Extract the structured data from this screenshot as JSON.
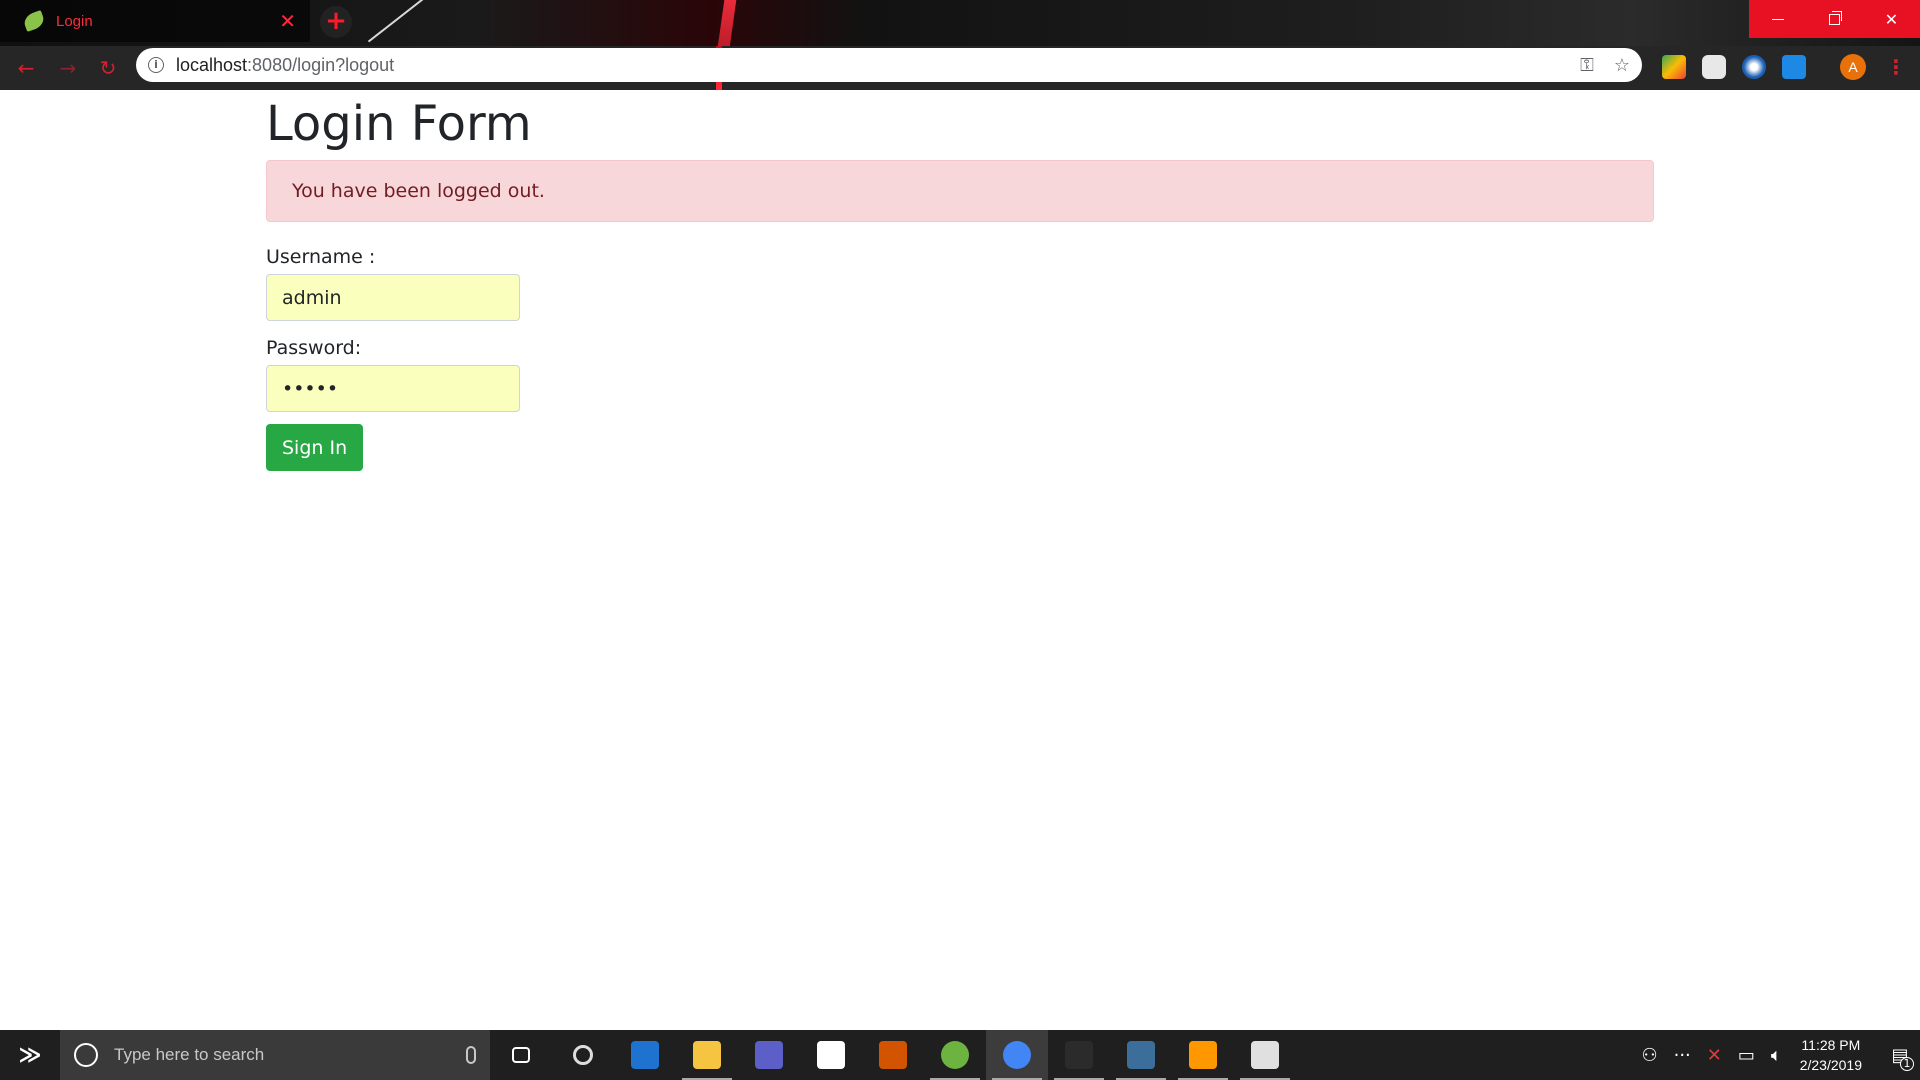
{
  "browser": {
    "tab_title": "Login",
    "tab_close": "✕",
    "new_tab": "+",
    "url_host": "localhost",
    "url_rest": ":8080/login?logout",
    "profile_initial": "A"
  },
  "page": {
    "title": "Login Form",
    "alert_message": "You have been logged out.",
    "username_label": "Username :",
    "username_value": "admin",
    "password_label": "Password:",
    "password_value": "admin",
    "submit_label": "Sign In"
  },
  "taskbar": {
    "search_placeholder": "Type here to search",
    "time": "11:28 PM",
    "date": "2/23/2019",
    "notification_count": "1",
    "apps": [
      {
        "name": "task-view",
        "color": "#ffffff"
      },
      {
        "name": "search",
        "color": "#dddddd"
      },
      {
        "name": "edge",
        "color": "#1e73d0"
      },
      {
        "name": "file-explorer",
        "color": "#f5c542"
      },
      {
        "name": "teams-like",
        "color": "#5b5fc7"
      },
      {
        "name": "store",
        "color": "#ffffff"
      },
      {
        "name": "sublime-like",
        "color": "#d35400"
      },
      {
        "name": "spring-tool",
        "color": "#6db33f"
      },
      {
        "name": "chrome",
        "color": "#4285f4"
      },
      {
        "name": "mysql-cli",
        "color": "#2b2b2b"
      },
      {
        "name": "mysql-workbench",
        "color": "#3b6e9a"
      },
      {
        "name": "sublime-text",
        "color": "#ff9800"
      },
      {
        "name": "paint",
        "color": "#e0e0e0"
      }
    ]
  },
  "colors": {
    "accent": "#e81123",
    "alert_bg": "#f8d7da",
    "alert_text": "#721c24",
    "autofill_bg": "#faffbd",
    "button_green": "#28a745"
  }
}
